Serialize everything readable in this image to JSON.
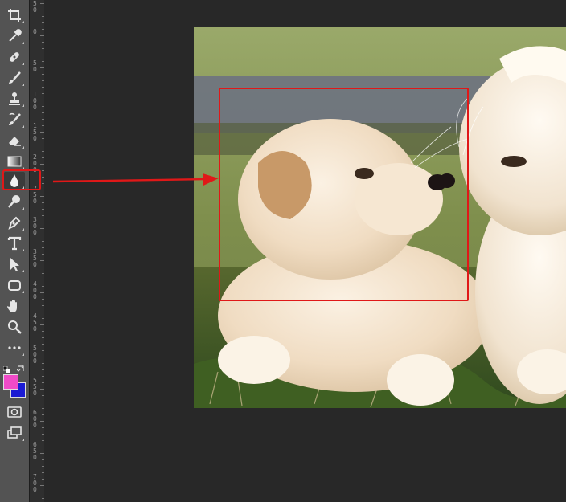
{
  "toolbar": {
    "tools": [
      {
        "name": "crop-icon",
        "selected": false
      },
      {
        "name": "eyedropper-icon",
        "selected": false
      },
      {
        "name": "healing-brush-icon",
        "selected": false
      },
      {
        "name": "brush-icon",
        "selected": false
      },
      {
        "name": "clone-stamp-icon",
        "selected": false
      },
      {
        "name": "history-brush-icon",
        "selected": false
      },
      {
        "name": "eraser-icon",
        "selected": false
      },
      {
        "name": "gradient-icon",
        "selected": false
      },
      {
        "name": "blur-icon",
        "selected": true
      },
      {
        "name": "dodge-icon",
        "selected": false
      },
      {
        "name": "pen-icon",
        "selected": false
      },
      {
        "name": "type-icon",
        "selected": false,
        "glyph": "T"
      },
      {
        "name": "path-selection-icon",
        "selected": false
      },
      {
        "name": "rectangle-shape-icon",
        "selected": false
      },
      {
        "name": "hand-icon",
        "selected": false
      },
      {
        "name": "zoom-icon",
        "selected": false
      },
      {
        "name": "more-tools-icon",
        "selected": false,
        "glyph": "···"
      },
      {
        "name": "quick-mask-icon",
        "selected": false
      },
      {
        "name": "screen-mode-icon",
        "selected": false
      }
    ],
    "foreground_color": "#f04bc8",
    "background_color": "#1b1bd4"
  },
  "ruler": {
    "labels": [
      "50",
      "0",
      "50",
      "100",
      "150",
      "200",
      "250",
      "300",
      "350",
      "400",
      "450",
      "500",
      "550",
      "600",
      "650",
      "700"
    ]
  },
  "annotation": {
    "highlight_color": "#e01818"
  }
}
